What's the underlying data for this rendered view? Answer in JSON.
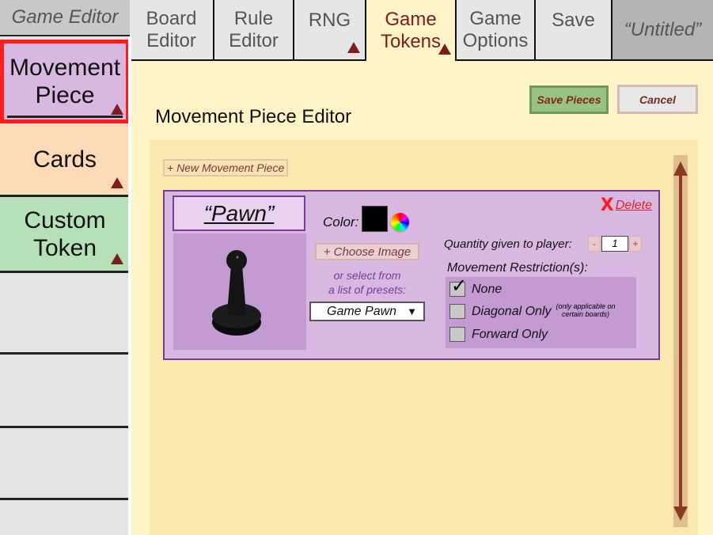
{
  "app": {
    "title": "Game Editor"
  },
  "tabs": [
    {
      "label": "Board\nEditor",
      "active": false,
      "has_indicator": false
    },
    {
      "label": "Rule\nEditor",
      "active": false,
      "has_indicator": false
    },
    {
      "label": "RNG",
      "active": false,
      "has_indicator": true
    },
    {
      "label": "Game\nTokens",
      "active": true,
      "has_indicator": true
    },
    {
      "label": "Game\nOptions",
      "active": false,
      "has_indicator": false
    },
    {
      "label": "Save",
      "active": false,
      "has_indicator": false
    },
    {
      "label": "“Untitled”",
      "active": false,
      "has_indicator": false
    }
  ],
  "sidebar": {
    "items": [
      {
        "label": "Movement\nPiece",
        "selected": true,
        "color": "#d8b8e0",
        "icon": "triangle-up-icon"
      },
      {
        "label": "Cards",
        "selected": false,
        "color": "#fddab7",
        "icon": "triangle-up-icon"
      },
      {
        "label": "Custom\nToken",
        "selected": false,
        "color": "#b6e0b8",
        "icon": "triangle-up-icon"
      }
    ]
  },
  "main": {
    "title": "Movement Piece Editor",
    "save_label": "Save Pieces",
    "cancel_label": "Cancel",
    "new_piece_label": "+ New Movement Piece"
  },
  "piece": {
    "name": "“Pawn”",
    "image_icon": "game-pawn-icon",
    "color_label": "Color:",
    "color_value": "#000000",
    "choose_image_label": "+ Choose Image",
    "preset_hint": "or select from\na list of presets:",
    "preset_selected": "Game Pawn",
    "delete_label": "Delete",
    "quantity_label": "Quantity given to player:",
    "quantity_minus": "-",
    "quantity_value": "1",
    "quantity_plus": "+",
    "restrictions_label": "Movement Restriction(s):",
    "restrictions": [
      {
        "label": "None",
        "checked": true,
        "note": ""
      },
      {
        "label": "Diagonal Only",
        "checked": false,
        "note": "(only applicable on\ncertain boards)"
      },
      {
        "label": "Forward Only",
        "checked": false,
        "note": ""
      }
    ]
  },
  "colors": {
    "accent": "#7a1e1e",
    "selection_outline": "#ff1c1c",
    "delete": "#e0202a"
  }
}
